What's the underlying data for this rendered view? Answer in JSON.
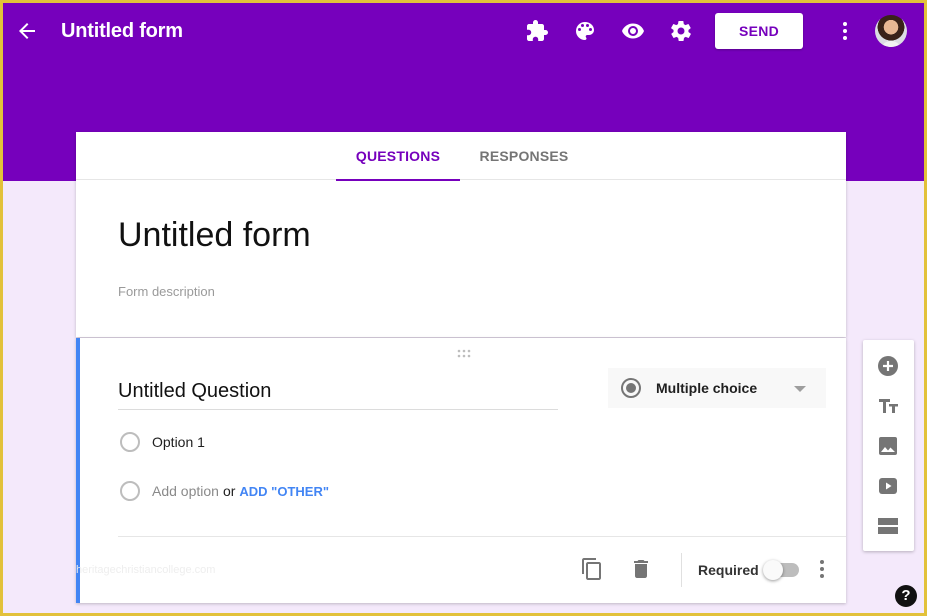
{
  "header": {
    "title": "Untitled form",
    "icons": [
      "back-arrow-icon",
      "addons-puzzle-icon",
      "palette-icon",
      "preview-eye-icon",
      "settings-gear-icon",
      "more-vert-icon"
    ],
    "send_label": "SEND",
    "brand_color": "#7600bc"
  },
  "tabs": [
    {
      "label": "QUESTIONS",
      "active": true
    },
    {
      "label": "RESPONSES",
      "active": false
    }
  ],
  "form": {
    "title": "Untitled form",
    "description_placeholder": "Form description"
  },
  "question": {
    "title": "Untitled Question",
    "type": "Multiple choice",
    "options": [
      "Option 1"
    ],
    "add_option_label": "Add option",
    "or_label": "or",
    "add_other_label": "ADD \"OTHER\"",
    "required_label": "Required",
    "required": false,
    "accent_color": "#4285f4"
  },
  "watermark": "heritagechristiancollege.com",
  "side_toolbar": [
    "add-question-icon",
    "add-title-icon",
    "add-image-icon",
    "add-video-icon",
    "add-section-icon"
  ],
  "help_label": "?"
}
